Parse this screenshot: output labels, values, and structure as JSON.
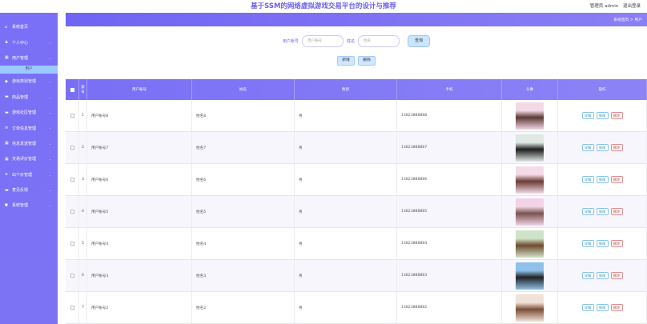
{
  "header": {
    "title": "基于SSM的网络虚拟游戏交易平台的设计与推荐",
    "admin": "管理员 admin",
    "logout": "退出登录"
  },
  "breadcrumb": {
    "path": "系统首页 > 用户"
  },
  "sidebar": {
    "items": [
      {
        "label": "系统首页",
        "icon": "home-icon"
      },
      {
        "label": "个人中心",
        "icon": "user-icon"
      },
      {
        "label": "用户管理",
        "icon": "grid-icon",
        "sub": "用户"
      },
      {
        "label": "游戏类别管理",
        "icon": "gem-icon"
      },
      {
        "label": "商品管理",
        "icon": "folder-icon"
      },
      {
        "label": "游戏社区管理",
        "icon": "folder-icon"
      },
      {
        "label": "订单信息管理",
        "icon": "list-icon"
      },
      {
        "label": "信息发送管理",
        "icon": "grid-icon"
      },
      {
        "label": "交易评价管理",
        "icon": "grid-icon"
      },
      {
        "label": "出个价管理",
        "icon": "send-icon"
      },
      {
        "label": "意见反馈",
        "icon": "folder-icon"
      },
      {
        "label": "系统管理",
        "icon": "shield-icon"
      }
    ]
  },
  "search": {
    "account_label": "用户账号",
    "account_placeholder": "用户账号",
    "name_label": "姓名",
    "name_placeholder": "姓名",
    "button": "查询"
  },
  "actions": {
    "add": "新增",
    "delete": "删除"
  },
  "table": {
    "headers": {
      "index": "索\n号",
      "account": "用户账号",
      "name": "姓名",
      "sex": "性别",
      "phone": "手机",
      "avatar": "头像",
      "op": "操作"
    },
    "op_labels": {
      "detail": "详情",
      "edit": "修改",
      "delete": "删除"
    },
    "rows": [
      {
        "index": "1",
        "account": "用户账号8",
        "name": "姓名8",
        "sex": "男",
        "phone": "13823888888",
        "avatar_colors": [
          "#f3d9e6",
          "#5b3a33"
        ]
      },
      {
        "index": "2",
        "account": "用户账号7",
        "name": "姓名7",
        "sex": "男",
        "phone": "13823888887",
        "avatar_colors": [
          "#dfe8e3",
          "#1e1e1e"
        ]
      },
      {
        "index": "3",
        "account": "用户账号6",
        "name": "姓名6",
        "sex": "男",
        "phone": "13823888886",
        "avatar_colors": [
          "#f4dbe7",
          "#6b3b33"
        ]
      },
      {
        "index": "4",
        "account": "用户账号5",
        "name": "姓名5",
        "sex": "男",
        "phone": "13823888885",
        "avatar_colors": [
          "#f3d4e6",
          "#7a5350"
        ]
      },
      {
        "index": "5",
        "account": "用户账号4",
        "name": "姓名4",
        "sex": "男",
        "phone": "13823888884",
        "avatar_colors": [
          "#cfe3c9",
          "#6f4a2e"
        ]
      },
      {
        "index": "6",
        "account": "用户账号3",
        "name": "姓名3",
        "sex": "男",
        "phone": "13823888883",
        "avatar_colors": [
          "#8fc1ea",
          "#222"
        ]
      },
      {
        "index": "7",
        "account": "用户账号2",
        "name": "姓名2",
        "sex": "男",
        "phone": "13823888882",
        "avatar_colors": [
          "#f1e2d8",
          "#7a4d35"
        ]
      }
    ]
  }
}
